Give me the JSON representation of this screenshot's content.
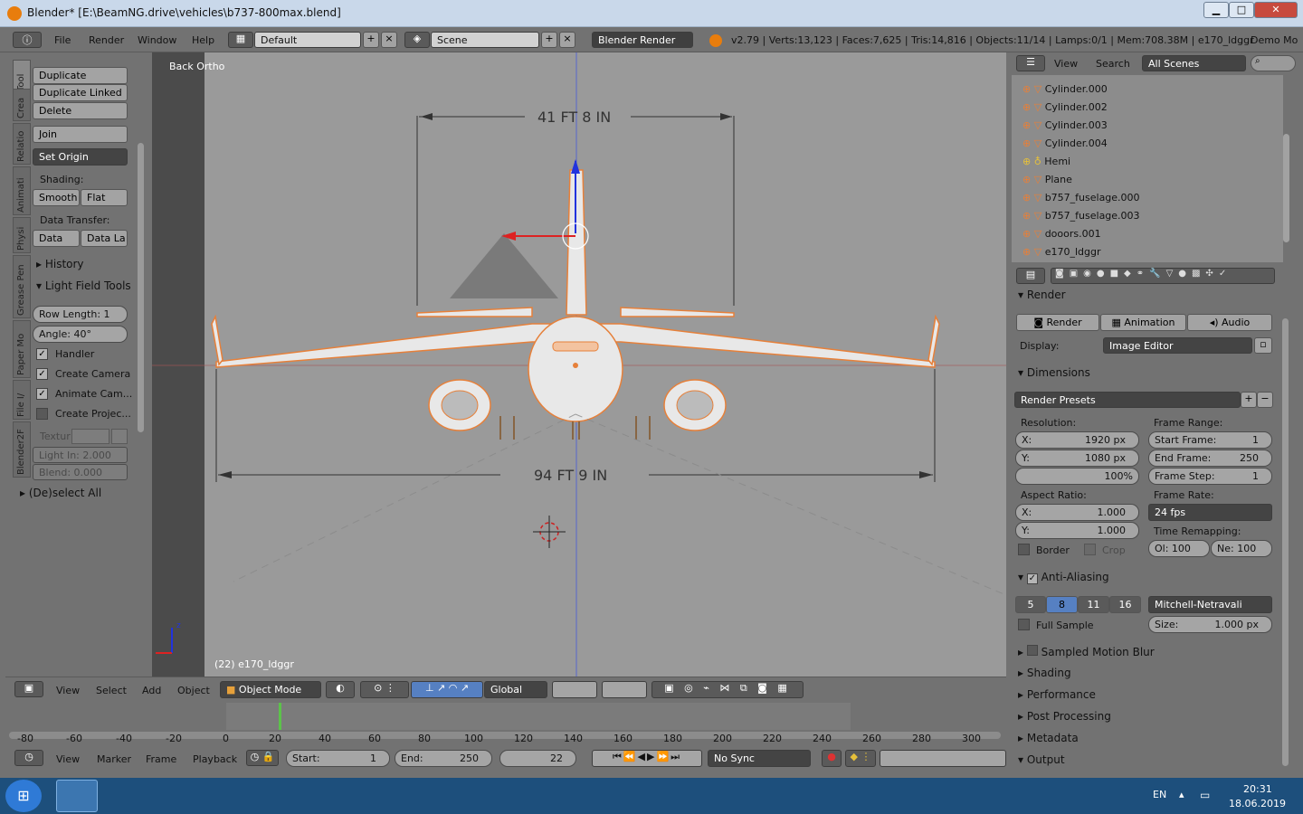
{
  "titlebar": {
    "title": "Blender* [E:\\BeamNG.drive\\vehicles\\b737-800max.blend]",
    "min": "▁",
    "max": "□",
    "close": "✕"
  },
  "infobar": {
    "menus": [
      "File",
      "Render",
      "Window",
      "Help"
    ],
    "layout": "Default",
    "scene": "Scene",
    "engine": "Blender Render",
    "stats": "v2.79 | Verts:13,123 | Faces:7,625 | Tris:14,816 | Objects:11/14 | Lamps:0/1 | Mem:708.38M | e170_ldggr",
    "demo": "Demo Mo"
  },
  "tools": {
    "tabs": [
      "Tool",
      "Crea",
      "Relatio",
      "Animati",
      "Physi",
      "Grease Pen",
      "Paper Mo",
      "File I/",
      "Blender2F"
    ],
    "duplicate": "Duplicate",
    "duplicate_linked": "Duplicate Linked",
    "delete": "Delete",
    "join": "Join",
    "set_origin": "Set Origin",
    "shading_label": "Shading:",
    "smooth": "Smooth",
    "flat": "Flat",
    "data_transfer": "Data Transfer:",
    "data": "Data",
    "data_la": "Data La",
    "history": "History",
    "lft": "Light Field Tools",
    "row_length": "Row Length:  1",
    "angle": "Angle:      40°",
    "handler": "Handler",
    "create_camera": "Create Camera",
    "animate_cam": "Animate Cam...",
    "create_proj": "Create Projec...",
    "textur": "Textur",
    "light_in": "Light In: 2.000",
    "blend": "Blend:   0.000",
    "deselect": "(De)select All"
  },
  "viewport": {
    "view_label": "Back Ortho",
    "object_label": "(22) e170_ldggr",
    "dim_top": "41 FT 8 IN",
    "dim_bottom": "94 FT 9 IN",
    "axis_z": "z"
  },
  "header3d": {
    "view": "View",
    "select": "Select",
    "add": "Add",
    "object": "Object",
    "mode": "Object Mode",
    "orientation": "Global"
  },
  "timeline": {
    "ticks": [
      "-80",
      "-60",
      "-40",
      "-20",
      "0",
      "20",
      "40",
      "60",
      "80",
      "100",
      "120",
      "140",
      "160",
      "180",
      "200",
      "220",
      "240",
      "260",
      "280",
      "300"
    ],
    "view": "View",
    "marker": "Marker",
    "frame": "Frame",
    "playback": "Playback",
    "start": "Start:",
    "start_val": "1",
    "end": "End:",
    "end_val": "250",
    "current": "22",
    "sync": "No Sync"
  },
  "outliner": {
    "view": "View",
    "search": "Search",
    "scenes": "All Scenes",
    "items": [
      "Cylinder.000",
      "Cylinder.002",
      "Cylinder.003",
      "Cylinder.004",
      "Hemi",
      "Plane",
      "b757_fuselage.000",
      "b757_fuselage.003",
      "dooors.001",
      "e170_ldggr"
    ]
  },
  "props": {
    "render_head": "Render",
    "render_btn": "Render",
    "animation_btn": "Animation",
    "audio_btn": "Audio",
    "display_label": "Display:",
    "display_val": "Image Editor",
    "dimensions": "Dimensions",
    "presets": "Render Presets",
    "resolution": "Resolution:",
    "res_x": "X:",
    "res_x_val": "1920 px",
    "res_y": "Y:",
    "res_y_val": "1080 px",
    "res_pct": "100%",
    "frame_range": "Frame Range:",
    "start_frame": "Start Frame:",
    "start_frame_val": "1",
    "end_frame": "End Frame:",
    "end_frame_val": "250",
    "frame_step": "Frame Step:",
    "frame_step_val": "1",
    "aspect": "Aspect Ratio:",
    "asp_x": "X:",
    "asp_x_val": "1.000",
    "asp_y": "Y:",
    "asp_y_val": "1.000",
    "frame_rate": "Frame Rate:",
    "fps": "24 fps",
    "time_remap": "Time Remapping:",
    "old": "Ol: 100",
    "new": "Ne: 100",
    "border": "Border",
    "crop": "Crop",
    "aa": "Anti-Aliasing",
    "aa5": "5",
    "aa8": "8",
    "aa11": "11",
    "aa16": "16",
    "filter": "Mitchell-Netravali",
    "full_sample": "Full Sample",
    "size": "Size:",
    "size_val": "1.000 px",
    "smb": "Sampled Motion Blur",
    "shading": "Shading",
    "performance": "Performance",
    "post": "Post Processing",
    "metadata": "Metadata",
    "output": "Output"
  },
  "taskbar": {
    "lang": "EN",
    "time": "20:31",
    "date": "18.06.2019"
  },
  "colors": {
    "accent_blue": "#5680c2",
    "orange": "#e0782a",
    "bg": "#727272",
    "viewport": "#9a9a9a"
  }
}
